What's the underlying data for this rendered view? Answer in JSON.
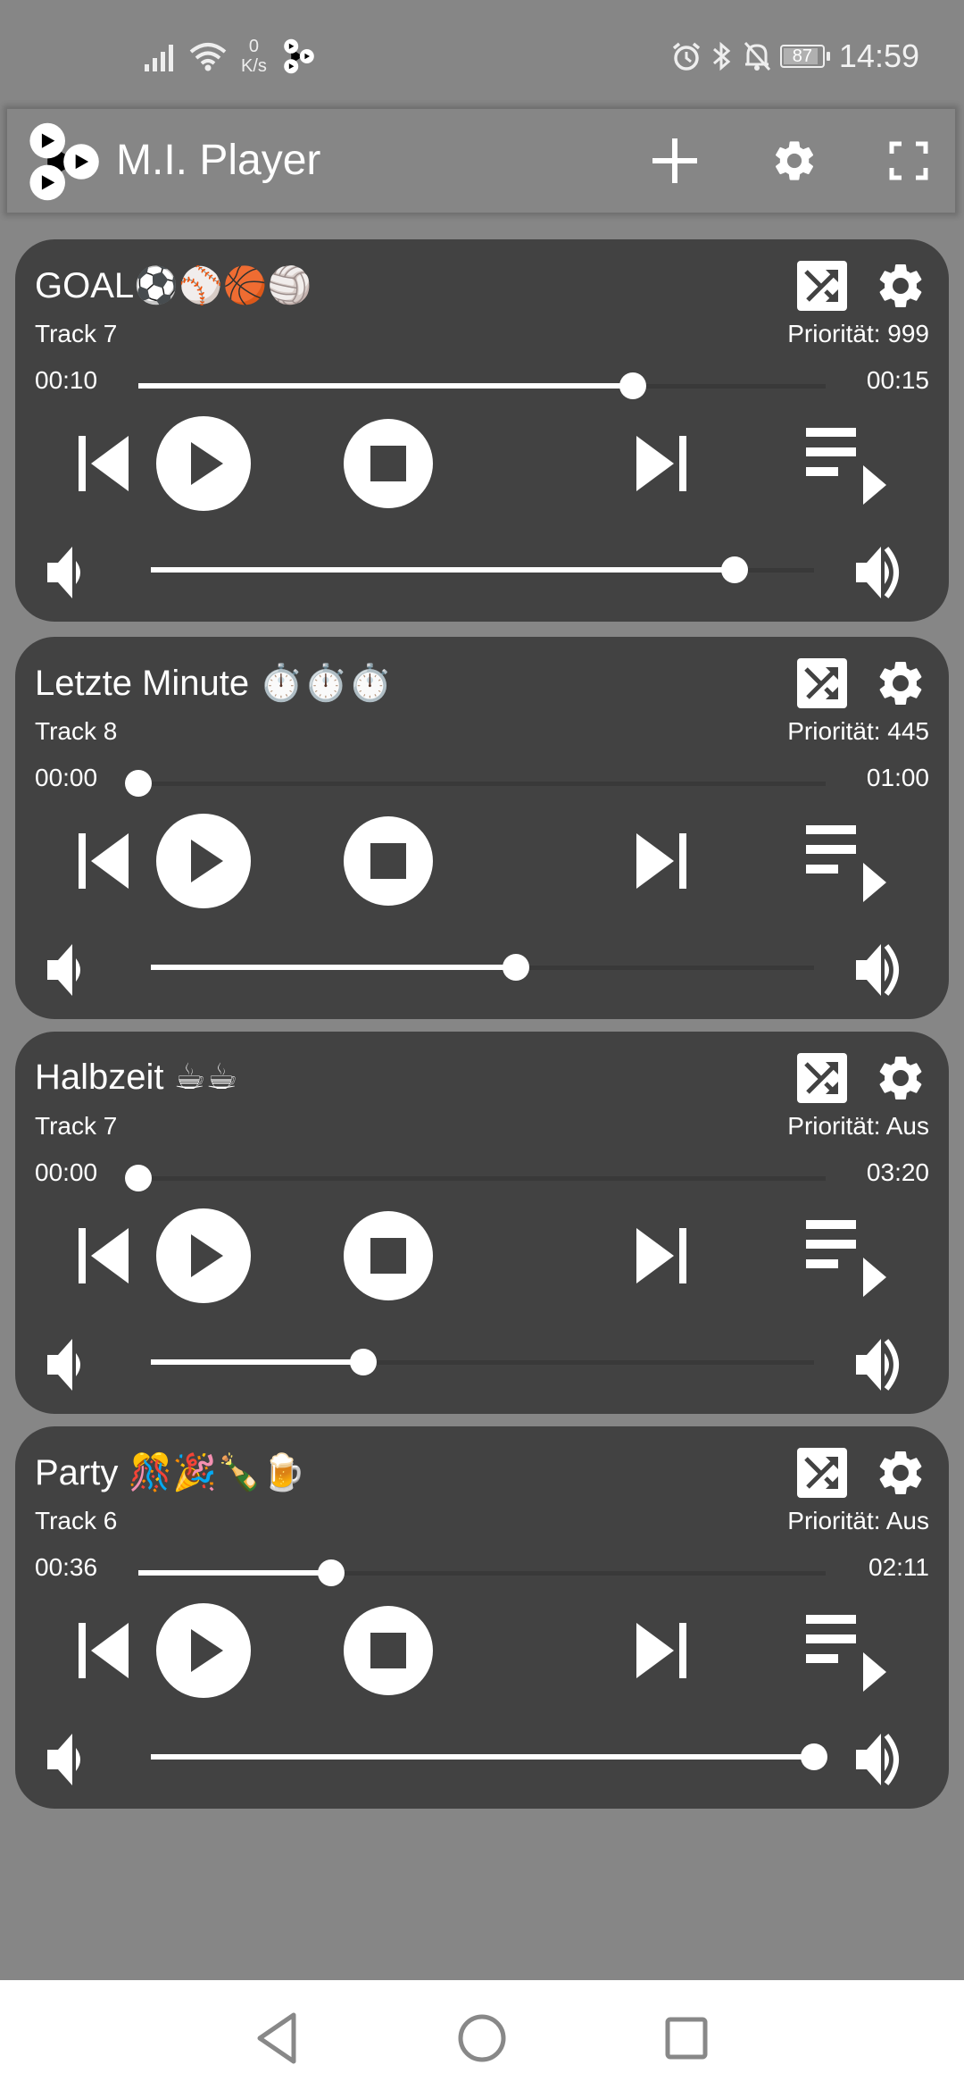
{
  "status_bar": {
    "net_speed_value": "0",
    "net_speed_unit": "K/s",
    "battery": "87",
    "time": "14:59"
  },
  "app_bar": {
    "title": "M.I. Player",
    "add_icon": "plus-icon",
    "settings_icon": "gear-icon",
    "fullscreen_icon": "fullscreen-icon"
  },
  "players": [
    {
      "title": "GOAL⚽⚾🏀🏐",
      "track": "Track 7",
      "priority": "Priorität: 999",
      "current_time": "00:10",
      "total_time": "00:15",
      "progress": 0.72,
      "volume": 0.88
    },
    {
      "title": "Letzte Minute ⏱️⏱️⏱️",
      "track": "Track 8",
      "priority": "Priorität: 445",
      "current_time": "00:00",
      "total_time": "01:00",
      "progress": 0.0,
      "volume": 0.55
    },
    {
      "title": "Halbzeit ☕☕",
      "track": "Track 7",
      "priority": "Priorität: Aus",
      "current_time": "00:00",
      "total_time": "03:20",
      "progress": 0.0,
      "volume": 0.32
    },
    {
      "title": "Party 🎊🎉🍾🍺",
      "track": "Track 6",
      "priority": "Priorität: Aus",
      "current_time": "00:36",
      "total_time": "02:11",
      "progress": 0.28,
      "volume": 1.0
    }
  ],
  "controls": [
    "previous-icon",
    "play-icon",
    "stop-icon",
    "next-icon",
    "playlist-icon"
  ],
  "nav_bar": [
    "back-icon",
    "home-icon",
    "recents-icon"
  ]
}
